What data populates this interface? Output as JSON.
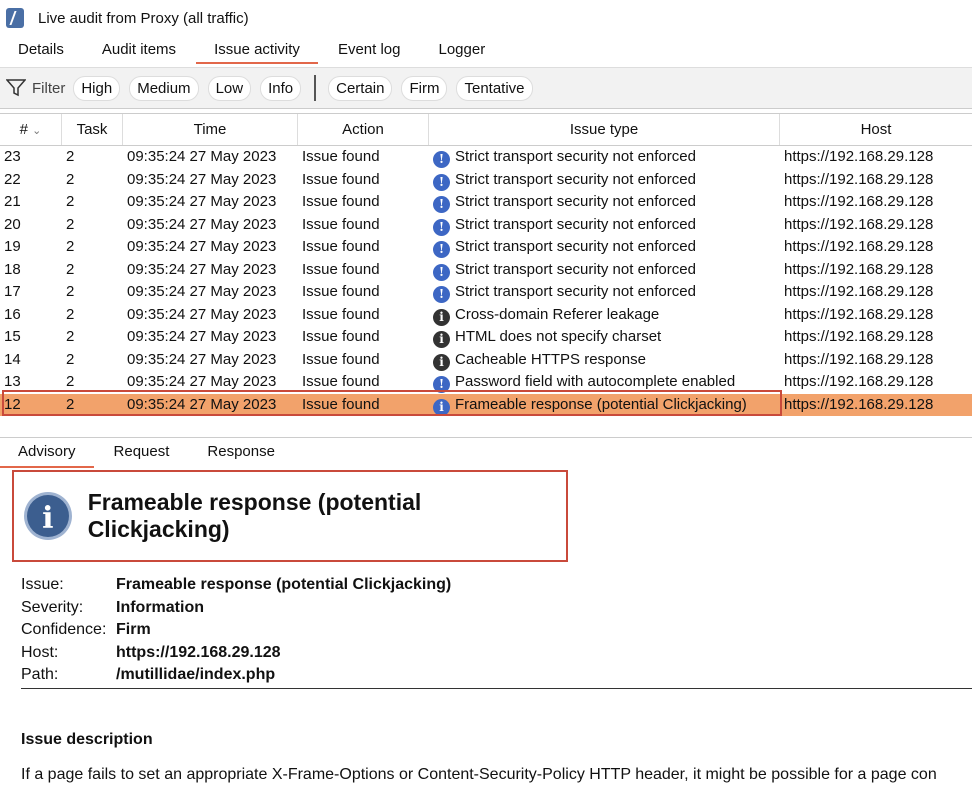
{
  "window": {
    "title": "Live audit from Proxy (all traffic)"
  },
  "top_tabs": [
    "Details",
    "Audit items",
    "Issue activity",
    "Event log",
    "Logger"
  ],
  "filter": {
    "label": "Filter",
    "severity": [
      "High",
      "Medium",
      "Low",
      "Info"
    ],
    "confidence": [
      "Certain",
      "Firm",
      "Tentative"
    ]
  },
  "table": {
    "columns": [
      "#",
      "Task",
      "Time",
      "Action",
      "Issue type",
      "Host"
    ],
    "rows": [
      {
        "num": "23",
        "task": "2",
        "time": "09:35:24 27 May 2023",
        "action": "Issue found",
        "issue": "Strict transport security not enforced",
        "host": "https://192.168.29.128"
      },
      {
        "num": "22",
        "task": "2",
        "time": "09:35:24 27 May 2023",
        "action": "Issue found",
        "issue": "Strict transport security not enforced",
        "host": "https://192.168.29.128"
      },
      {
        "num": "21",
        "task": "2",
        "time": "09:35:24 27 May 2023",
        "action": "Issue found",
        "issue": "Strict transport security not enforced",
        "host": "https://192.168.29.128"
      },
      {
        "num": "20",
        "task": "2",
        "time": "09:35:24 27 May 2023",
        "action": "Issue found",
        "issue": "Strict transport security not enforced",
        "host": "https://192.168.29.128"
      },
      {
        "num": "19",
        "task": "2",
        "time": "09:35:24 27 May 2023",
        "action": "Issue found",
        "issue": "Strict transport security not enforced",
        "host": "https://192.168.29.128"
      },
      {
        "num": "18",
        "task": "2",
        "time": "09:35:24 27 May 2023",
        "action": "Issue found",
        "issue": "Strict transport security not enforced",
        "host": "https://192.168.29.128"
      },
      {
        "num": "17",
        "task": "2",
        "time": "09:35:24 27 May 2023",
        "action": "Issue found",
        "issue": "Strict transport security not enforced",
        "host": "https://192.168.29.128"
      },
      {
        "num": "16",
        "task": "2",
        "time": "09:35:24 27 May 2023",
        "action": "Issue found",
        "issue": "Cross-domain Referer leakage",
        "host": "https://192.168.29.128"
      },
      {
        "num": "15",
        "task": "2",
        "time": "09:35:24 27 May 2023",
        "action": "Issue found",
        "issue": "HTML does not specify charset",
        "host": "https://192.168.29.128"
      },
      {
        "num": "14",
        "task": "2",
        "time": "09:35:24 27 May 2023",
        "action": "Issue found",
        "issue": "Cacheable HTTPS response",
        "host": "https://192.168.29.128"
      },
      {
        "num": "13",
        "task": "2",
        "time": "09:35:24 27 May 2023",
        "action": "Issue found",
        "issue": "Password field with autocomplete enabled",
        "host": "https://192.168.29.128"
      },
      {
        "num": "12",
        "task": "2",
        "time": "09:35:24 27 May 2023",
        "action": "Issue found",
        "issue": "Frameable response (potential Clickjacking)",
        "host": "https://192.168.29.128"
      }
    ]
  },
  "bottom_tabs": [
    "Advisory",
    "Request",
    "Response"
  ],
  "advisory": {
    "title": "Frameable response (potential Clickjacking)",
    "labels": [
      "Issue:",
      "Severity:",
      "Confidence:",
      "Host:",
      "Path:"
    ],
    "values": [
      "Frameable response (potential Clickjacking)",
      "Information",
      "Firm",
      "https://192.168.29.128",
      "/mutillidae/index.php"
    ],
    "section_title": "Issue description",
    "description": "If a page fails to set an appropriate X-Frame-Options or Content-Security-Policy HTTP header, it might be possible for a page con"
  },
  "colors": {
    "accent": "#e2674a",
    "selected_row": "#f2a26b",
    "highlight_box": "#c94a3b",
    "info_icon": "#3d67c4"
  }
}
